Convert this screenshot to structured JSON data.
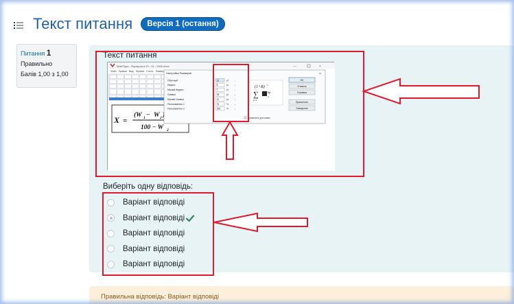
{
  "header": {
    "title": "Текст питання",
    "badge": "Версія 1 (остання)"
  },
  "info": {
    "qno_label": "Питання",
    "qno_number": "1",
    "state": "Правильно",
    "grade": "Балів 1,00 з 1,00"
  },
  "question": {
    "text": "Текст питання",
    "prompt": "Виберіть одну відповідь:",
    "answers": [
      {
        "label": "Варіант відповіді",
        "selected": false,
        "correct_mark": false
      },
      {
        "label": "Варіант відповіді",
        "selected": true,
        "correct_mark": true
      },
      {
        "label": "Варіант відповіді",
        "selected": false,
        "correct_mark": false
      },
      {
        "label": "Варіант відповіді",
        "selected": false,
        "correct_mark": false
      },
      {
        "label": "Варіант відповіді",
        "selected": false,
        "correct_mark": false
      }
    ]
  },
  "feedback": {
    "right_answer": "Правильна відповідь: Варіант відповіді"
  },
  "colors": {
    "title": "#1f5fa6",
    "badge": "#0f6cbf",
    "annotation_red": "#e0192c",
    "formulation_bg": "#e7f3f5",
    "feedback_bg": "#fcefdc",
    "correct_green": "#2e8b57"
  },
  "screenshot_image": {
    "window_title": "MathType - Формула в 20 - 01 - 2000.docx",
    "menu": [
      "Файл",
      "Правка",
      "Вид",
      "Формат",
      "Стиль",
      "Размер",
      "Установки",
      "Справка"
    ],
    "dialog_title": "Настройка Размеров",
    "dialog_rows": [
      {
        "label": "Обычный",
        "value": "12",
        "unit": "pt"
      },
      {
        "label": "Индекс",
        "value": "8",
        "unit": "pt"
      },
      {
        "label": "Малый Индекс",
        "value": "7",
        "unit": "pt"
      },
      {
        "label": "Символ",
        "value": "16",
        "unit": "pt"
      },
      {
        "label": "Малый Символ",
        "value": "12",
        "unit": "pt"
      },
      {
        "label": "Пользователь 1",
        "value": "75",
        "unit": "%"
      },
      {
        "label": "Пользователь 2",
        "value": "150",
        "unit": "%"
      }
    ],
    "dialog_buttons": [
      "OK",
      "Отмена",
      "Справка",
      "Применить",
      "Заводские"
    ],
    "apply_checkbox": "Применить для новых",
    "formula": "X = (W1 − W2) 100 / (100 − W2)"
  }
}
